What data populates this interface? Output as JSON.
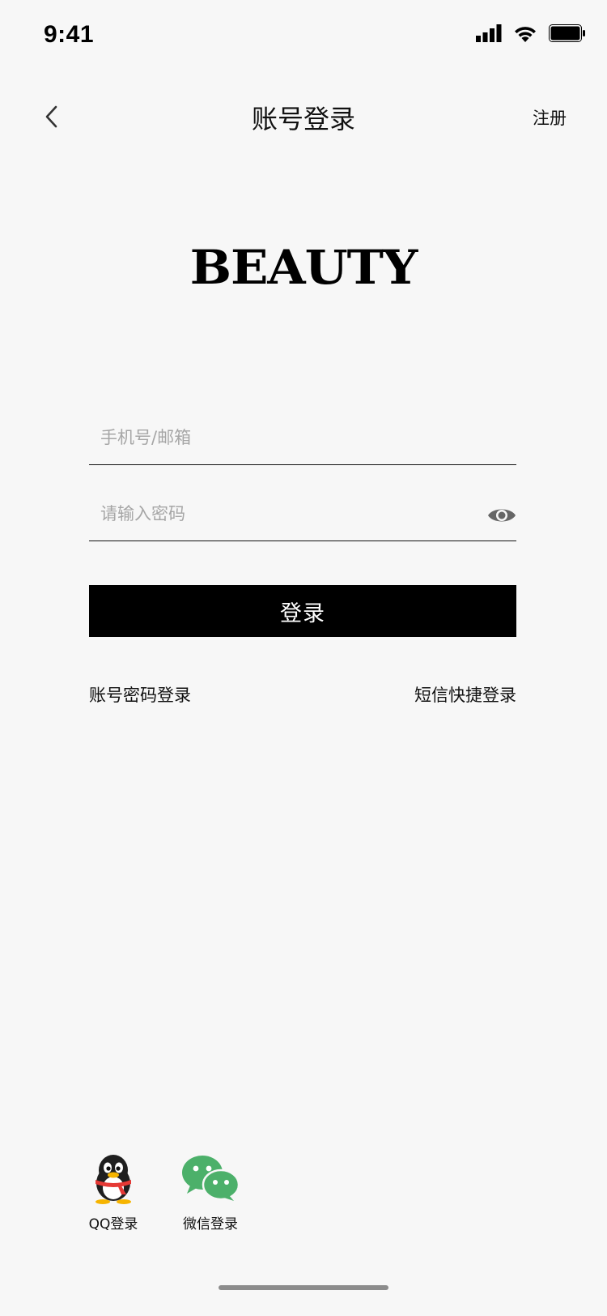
{
  "status_bar": {
    "time": "9:41"
  },
  "nav": {
    "title": "账号登录",
    "register": "注册"
  },
  "brand": {
    "logo_text": "BEAUTY"
  },
  "form": {
    "phone_placeholder": "手机号/邮箱",
    "password_placeholder": "请输入密码",
    "login_label": "登录"
  },
  "alt_login": {
    "password_login": "账号密码登录",
    "sms_login": "短信快捷登录"
  },
  "social": {
    "qq_label": "QQ登录",
    "wechat_label": "微信登录"
  },
  "colors": {
    "background": "#f7f7f7",
    "button_bg": "#000000",
    "placeholder": "#a6a6a6",
    "wechat_green": "#4cb06a",
    "qq_scarf": "#e53935",
    "qq_beak": "#f6b400"
  }
}
